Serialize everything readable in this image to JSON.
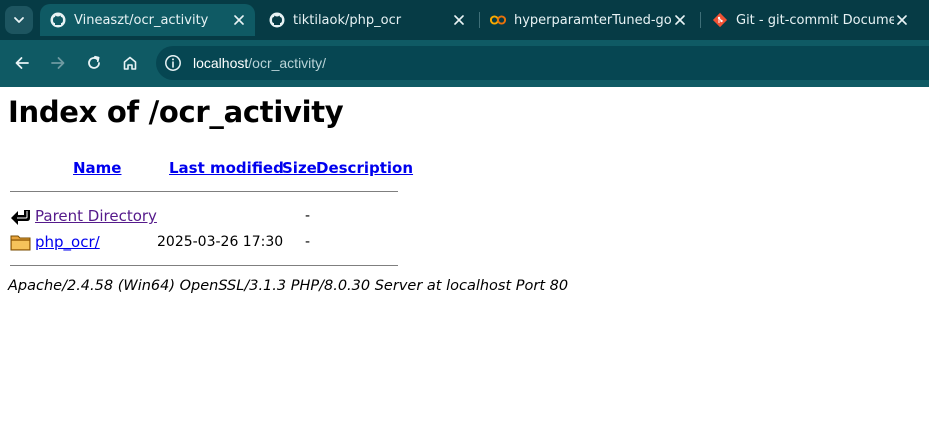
{
  "browser": {
    "tabs": [
      {
        "title": "Vineaszt/ocr_activity",
        "icon": "github-icon",
        "active": true
      },
      {
        "title": "tiktilaok/php_ocr",
        "icon": "github-icon",
        "active": false
      },
      {
        "title": "hyperparamterTuned-good/",
        "icon": "colab-icon",
        "active": false
      },
      {
        "title": "Git - git-commit Documenta",
        "icon": "git-icon",
        "active": false
      }
    ],
    "url_host": "localhost",
    "url_path": "/ocr_activity/"
  },
  "page": {
    "title": "Index of /ocr_activity",
    "columns": {
      "name": "Name",
      "modified": "Last modified",
      "size": "Size",
      "description": "Description"
    },
    "rows": [
      {
        "name": "Parent Directory",
        "modified": "",
        "size": "-",
        "icon": "back-arrow-icon"
      },
      {
        "name": "php_ocr/",
        "modified": "2025-03-26 17:30",
        "size": "-",
        "icon": "folder-icon"
      }
    ],
    "footer": "Apache/2.4.58 (Win64) OpenSSL/3.1.3 PHP/8.0.30 Server at localhost Port 80"
  },
  "colors": {
    "tab_strip": "#063b45",
    "toolbar": "#0f5a64",
    "link": "#0000ee",
    "visited": "#551a8b"
  }
}
